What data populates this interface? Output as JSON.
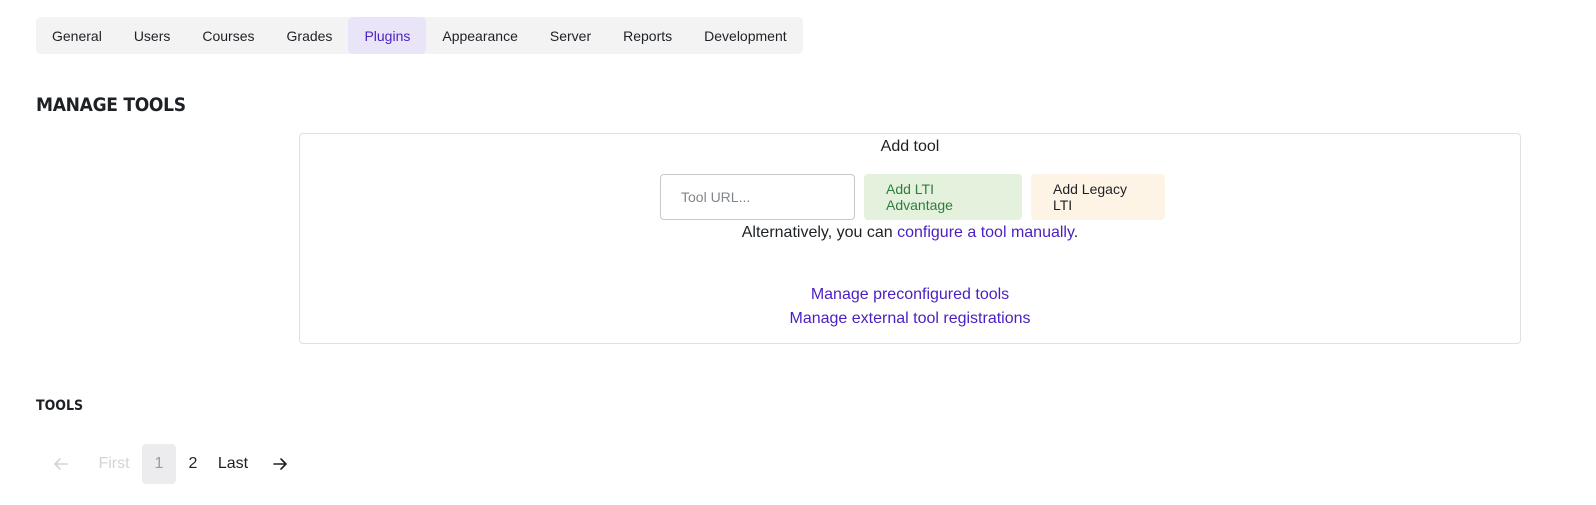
{
  "tabs": [
    {
      "label": "General",
      "active": false
    },
    {
      "label": "Users",
      "active": false
    },
    {
      "label": "Courses",
      "active": false
    },
    {
      "label": "Grades",
      "active": false
    },
    {
      "label": "Plugins",
      "active": true
    },
    {
      "label": "Appearance",
      "active": false
    },
    {
      "label": "Server",
      "active": false
    },
    {
      "label": "Reports",
      "active": false
    },
    {
      "label": "Development",
      "active": false
    }
  ],
  "page_title": "Manage tools",
  "add_tool": {
    "title": "Add tool",
    "url_placeholder": "Tool URL...",
    "url_value": "",
    "advantage_button": "Add LTI Advantage",
    "legacy_button": "Add Legacy LTI",
    "alt_prefix": "Alternatively, you can ",
    "alt_link": "configure a tool manually",
    "alt_suffix": ".",
    "preconfigured_link": "Manage preconfigured tools",
    "registrations_link": "Manage external tool registrations"
  },
  "tools_heading": "Tools",
  "pagination": {
    "prev_icon": "arrow-left-icon",
    "first": "First",
    "pages": [
      "1",
      "2"
    ],
    "current_page": "1",
    "last": "Last",
    "next_icon": "arrow-right-icon"
  },
  "colors": {
    "accent": "#4a1fc2",
    "active_tab_bg": "#e9e4f8",
    "advantage_bg": "#e4f1dd",
    "advantage_text": "#2f7d3e",
    "legacy_bg": "#fdf4e6"
  }
}
